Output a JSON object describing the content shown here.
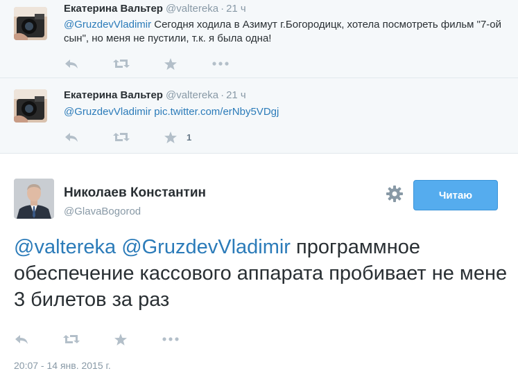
{
  "reply1": {
    "name": "Екатерина Вальтер",
    "handle": "@valtereka",
    "separator": "·",
    "time": "21 ч",
    "mention": "@GruzdevVladimir",
    "text": " Сегодня ходила в Азимут г.Богородицк, хотела посмотреть фильм \"7-ой сын\", но меня не пустили, т.к. я была одна!",
    "icons": {
      "reply": "reply-icon",
      "retweet": "retweet-icon",
      "favorite": "star-icon",
      "more": "more-icon"
    }
  },
  "reply2": {
    "name": "Екатерина Вальтер",
    "handle": "@valtereka",
    "separator": "·",
    "time": "21 ч",
    "mention": "@GruzdevVladimir",
    "link": "pic.twitter.com/erNby5VDgj",
    "favorite_count": "1"
  },
  "main": {
    "name": "Николаев Константин",
    "handle": "@GlavaBogorod",
    "follow_label": "Читаю",
    "mention1": "@valtereka",
    "mention2": "@GruzdevVladimir",
    "text": " программное обеспечение кассового аппарата пробивает не мене 3 билетов за раз",
    "timestamp": "20:07 - 14 янв. 2015 г."
  },
  "colors": {
    "link": "#2b7bb9",
    "follow_button": "#55acee",
    "muted": "#8899a6",
    "reply_bg": "#f5f8fa"
  }
}
